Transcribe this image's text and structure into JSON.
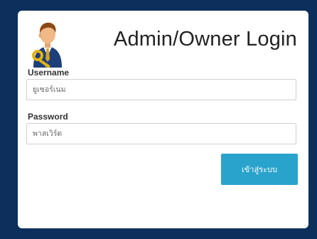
{
  "login": {
    "title": "Admin/Owner Login",
    "avatar_icon": "admin-with-key-icon",
    "username_label": "Username",
    "username_placeholder": "ยูเซอร์เนม",
    "username_value": "",
    "password_label": "Password",
    "password_placeholder": "พาสเวิร์ด",
    "password_value": "",
    "submit_label": "เข้าสู่ระบบ"
  },
  "colors": {
    "page_background": "#0c2f5c",
    "card_background": "#ffffff",
    "button": "#29a3cc"
  }
}
